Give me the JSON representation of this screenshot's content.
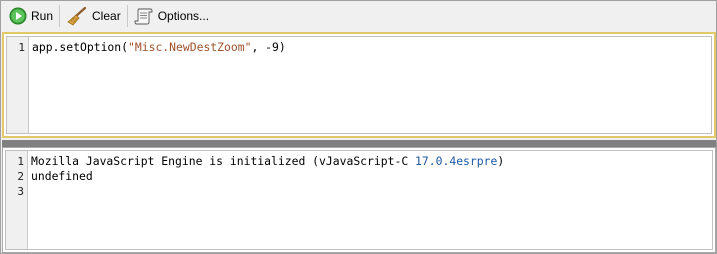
{
  "toolbar": {
    "run_label": "Run",
    "clear_label": "Clear",
    "options_label": "Options..."
  },
  "editor": {
    "line_numbers": [
      "1"
    ],
    "line1": {
      "prefix": "app.setOption(",
      "string": "\"Misc.NewDestZoom\"",
      "suffix": ", -9)"
    }
  },
  "output": {
    "line_numbers": [
      "1",
      "2",
      "3"
    ],
    "line1": {
      "prefix": "Mozilla JavaScript Engine is initialized (vJavaScript-C ",
      "version": "17.0.4esrpre",
      "suffix": ")"
    },
    "line2": "undefined",
    "line3": ""
  },
  "colors": {
    "editor_border": "#e3c869",
    "string": "#a0522d",
    "version": "#1c57a5",
    "splitter": "#808080"
  }
}
